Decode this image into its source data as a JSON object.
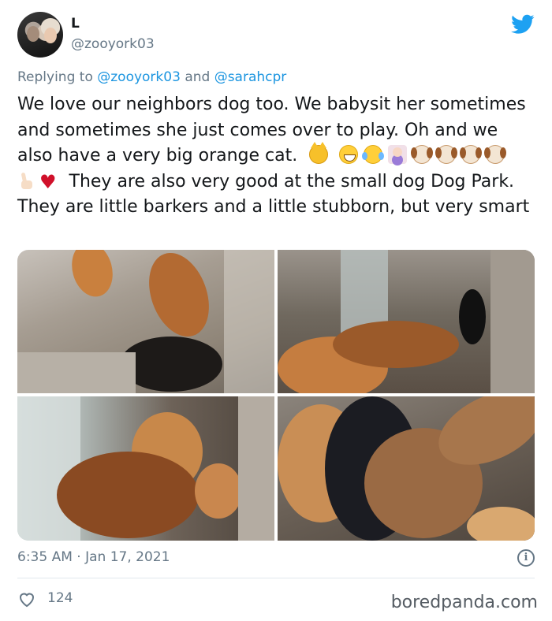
{
  "tweet": {
    "author_name": "L",
    "author_handle": "@zooyork03",
    "replying_prefix": "Replying to",
    "replying_mentions": [
      "@zooyork03",
      "@sarahcpr"
    ],
    "replying_conjunction": "and",
    "text_part1": "We love our neighbors dog too. We babysit her sometimes and sometimes she just comes over to play.  Oh and we also have a very big orange cat.",
    "emojis": [
      "cat-face",
      "grinning-face",
      "tears-of-joy",
      "woman-gesturing",
      "dog-face",
      "dog-face",
      "dog-face",
      "dog-face",
      "victory-hand",
      "red-heart"
    ],
    "text_part2": "They are also very good at the small dog Dog Park. They are little barkers and a little stubborn, but very smart",
    "timestamp": "6:35 AM · Jan 17, 2021",
    "info_label": "i",
    "like_count": "124"
  },
  "media": [
    {
      "name": "photo-dogs-hallway-top-left"
    },
    {
      "name": "photo-dogs-doorway"
    },
    {
      "name": "photo-cat-and-dog-window"
    },
    {
      "name": "photo-dogs-closeup"
    }
  ],
  "watermark": "boredpanda.com",
  "colors": {
    "accent": "#1da1f2",
    "secondary_text": "#657786",
    "heart": "#d0102a"
  }
}
